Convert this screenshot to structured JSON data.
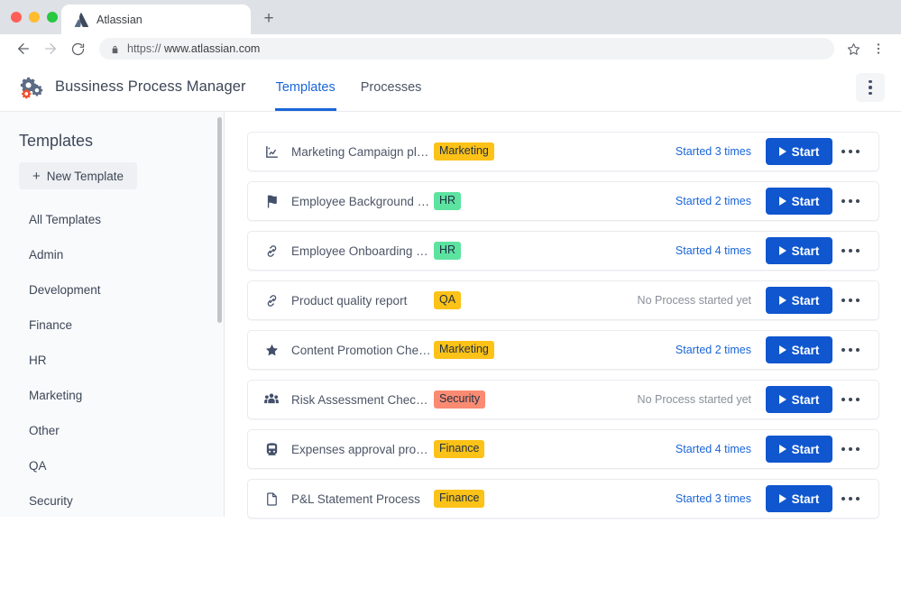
{
  "browser": {
    "tab_title": "Atlassian",
    "new_tab_label": "+",
    "url_scheme": "https://",
    "url_host": "www.atlassian.com",
    "back_icon": "back-arrow-icon",
    "forward_icon": "forward-arrow-icon",
    "reload_icon": "reload-icon",
    "lock_icon": "lock-icon",
    "bookmark_icon": "star-icon",
    "menu_icon": "browser-menu-icon"
  },
  "header": {
    "title": "Bussiness Process Manager",
    "logo_icon": "gears-logo-icon",
    "tabs": [
      {
        "label": "Templates",
        "active": true
      },
      {
        "label": "Processes",
        "active": false
      }
    ],
    "kebab_icon": "vertical-kebab-icon",
    "accent_color": "#1a65d8"
  },
  "sidebar": {
    "title": "Templates",
    "new_template_label": "New Template",
    "new_template_plus": "+",
    "items": [
      {
        "label": "All Templates"
      },
      {
        "label": "Admin"
      },
      {
        "label": "Development"
      },
      {
        "label": "Finance"
      },
      {
        "label": "HR"
      },
      {
        "label": "Marketing"
      },
      {
        "label": "Other"
      },
      {
        "label": "QA"
      },
      {
        "label": "Security"
      }
    ]
  },
  "tag_colors": {
    "Marketing": "#fcc217",
    "HR": "#5de3a0",
    "QA": "#fcc217",
    "Security": "#fa8b72",
    "Finance": "#fcc217"
  },
  "main": {
    "start_label": "Start",
    "no_process_label": "No Process started yet",
    "rows": [
      {
        "icon": "chart-line-icon",
        "title": "Marketing Campaign plan c...",
        "tag": "Marketing",
        "tag_color": "#fcc217",
        "status": "Started 3 times",
        "started": true,
        "start_label": "Start"
      },
      {
        "icon": "flag-icon",
        "title": "Employee Background Check",
        "tag": "HR",
        "tag_color": "#5de3a0",
        "status": "Started 2 times",
        "started": true,
        "start_label": "Start"
      },
      {
        "icon": "link-chain-icon",
        "title": "Employee Onboarding Chec...",
        "tag": "HR",
        "tag_color": "#5de3a0",
        "status": "Started 4 times",
        "started": true,
        "start_label": "Start"
      },
      {
        "icon": "link-chain-icon",
        "title": "Product quality report",
        "tag": "QA",
        "tag_color": "#fcc217",
        "status": "No Process started yet",
        "started": false,
        "start_label": "Start"
      },
      {
        "icon": "star-icon",
        "title": "Content Promotion Checklist",
        "tag": "Marketing",
        "tag_color": "#fcc217",
        "status": "Started 2 times",
        "started": true,
        "start_label": "Start"
      },
      {
        "icon": "users-group-icon",
        "title": "Risk Assessment Check List",
        "tag": "Security",
        "tag_color": "#fa8b72",
        "status": "No Process started yet",
        "started": false,
        "start_label": "Start"
      },
      {
        "icon": "train-icon",
        "title": "Expenses approval process",
        "tag": "Finance",
        "tag_color": "#fcc217",
        "status": "Started 4 times",
        "started": true,
        "start_label": "Start"
      },
      {
        "icon": "document-icon",
        "title": "P&L Statement Process",
        "tag": "Finance",
        "tag_color": "#fcc217",
        "status": "Started 3 times",
        "started": true,
        "start_label": "Start"
      }
    ]
  }
}
